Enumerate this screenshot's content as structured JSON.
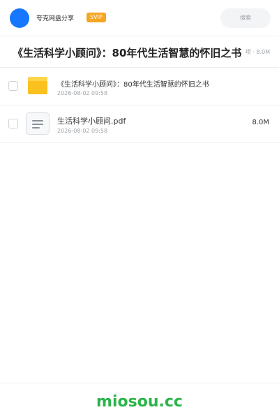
{
  "header": {
    "app_name": "夸克网盘分享",
    "badge": "SVIP",
    "search_label": "搜索",
    "accent_color": "#1677ff"
  },
  "title_bar": {
    "title": "《生活科学小顾问》：80年代生活智慧的怀旧之书",
    "meta_count": "项",
    "meta_size": "8.0M"
  },
  "files": [
    {
      "type": "folder",
      "icon": "folder-icon",
      "name": "《生活科学小顾问》：80年代生活智慧的怀旧之书",
      "date": "2026-08-02 09:58",
      "size": ""
    },
    {
      "type": "pdf",
      "icon": "document-icon",
      "name": "生活科学小顾问.pdf",
      "date": "2026-08-02 09:58",
      "size": "8.0M"
    }
  ],
  "footer": {
    "brand": "miosou.cc",
    "brand_color": "#2bb44a"
  }
}
